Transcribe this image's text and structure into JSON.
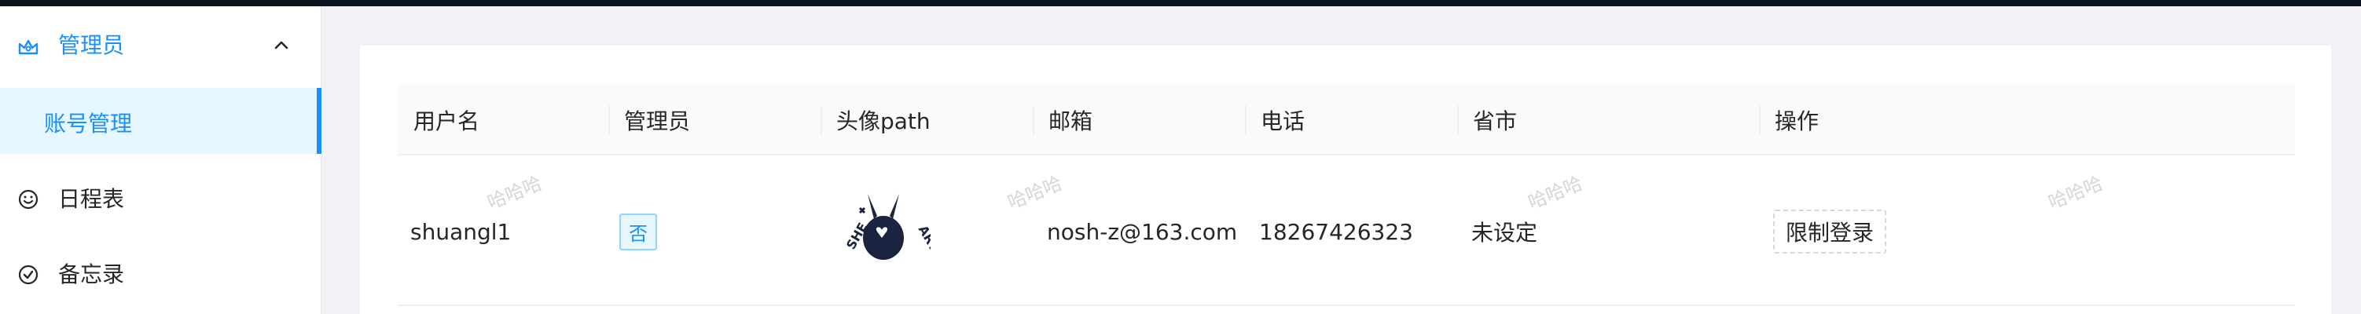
{
  "sidebar": {
    "group": {
      "label": "管理员",
      "icon": "crown-icon",
      "expanded_icon": "chevron-up-icon"
    },
    "active_subitem": {
      "label": "账号管理"
    },
    "items": [
      {
        "label": "日程表",
        "icon": "smile-icon"
      },
      {
        "label": "备忘录",
        "icon": "check-circle-icon"
      }
    ]
  },
  "table": {
    "columns": [
      "用户名",
      "管理员",
      "头像path",
      "邮箱",
      "电话",
      "省市",
      "操作"
    ],
    "rows": [
      {
        "username": "shuangl1",
        "is_admin": "否",
        "avatar": "rabbit-logo-avatar",
        "email": "nosh-z@163.com",
        "phone": "18267426323",
        "province_city": "未设定",
        "action": "限制登录"
      }
    ]
  },
  "watermark": {
    "text": "哈哈哈"
  },
  "colors": {
    "accent": "#1890ff",
    "topbar": "#0c1420",
    "background": "#f0f2f5"
  }
}
